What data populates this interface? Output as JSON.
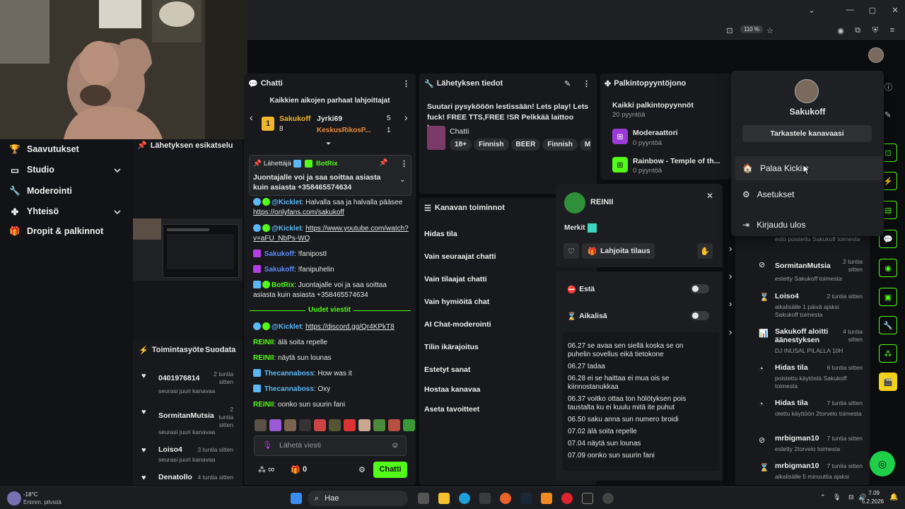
{
  "browser": {
    "zoom": "110 %"
  },
  "sidebar": {
    "items": [
      {
        "label": "Saavutukset",
        "icon": "trophy-icon"
      },
      {
        "label": "Studio",
        "icon": "studio-icon"
      },
      {
        "label": "Moderointi",
        "icon": "wrench-icon"
      },
      {
        "label": "Yhteisö",
        "icon": "community-icon"
      },
      {
        "label": "Dropit & palkinnot",
        "icon": "gift-icon"
      }
    ]
  },
  "preview": {
    "title": "Lähetyksen esikatselu"
  },
  "activity": {
    "title": "Toimintasyöte",
    "follow_label": "Suodata",
    "items": [
      {
        "name": "0401976814",
        "time": "2 tuntia sitten",
        "sub": "seurasi juuri kanavaa"
      },
      {
        "name": "SormitanMutsia",
        "time": "2 tuntia sitten",
        "sub": "seurasi juuri kanavaa"
      },
      {
        "name": "Loiso4",
        "time": "3 tuntia sitten",
        "sub": "seurasi juuri kanavaa"
      },
      {
        "name": "Denatollo",
        "time": "4 tuntia sitten",
        "sub": ""
      }
    ]
  },
  "chat": {
    "title": "Chatti",
    "gifters_title": "Kaikkien aikojen parhaat lahjoittajat",
    "gifters": [
      {
        "rank": "1",
        "name": "Sakukoff",
        "count": "8"
      },
      {
        "name": "Jyrki69",
        "count": "5"
      },
      {
        "name": "KeskusRikosP...",
        "count": "1"
      }
    ],
    "pinned": {
      "label": "Lähettäjä",
      "user": "BotRix",
      "text": "Juontajalle voi ja saa soittaa asiasta kuin asiasta +358465574634"
    },
    "messages": [
      {
        "user": "@Kicklet",
        "text": "Halvalla saa ja halvalla pääsee ",
        "link": "https://onlyfans.com/sakukoff"
      },
      {
        "user": "@Kicklet",
        "text": "",
        "link": "https://www.youtube.com/watch?v=aFU_NbPs-WQ"
      },
      {
        "user": "Sakukoff",
        "text": "!fanipostI"
      },
      {
        "user": "Sakukoff",
        "text": "!fanipuhelin"
      },
      {
        "user": "BotRix",
        "text": "Juontajalle voi ja saa soittaa asiasta kuin asiasta +358465574634"
      }
    ],
    "new_messages": "Uudet viestit",
    "messages2": [
      {
        "user": "@Kicklet",
        "link": "https://discord.gg/Qr4KPkT8"
      },
      {
        "user": "REINII",
        "text": "älä soita repelle"
      },
      {
        "user": "REINII",
        "text": "näytä sun lounas"
      },
      {
        "user": "Thecannaboss",
        "text": "How was it"
      },
      {
        "user": "Thecannaboss",
        "text": "Oxy"
      },
      {
        "user": "REINII",
        "text": "oonko sun suurin fani"
      }
    ],
    "input_placeholder": "Lähetä viesti",
    "points": "∞",
    "gifts": "0",
    "send_label": "Chatti"
  },
  "stream_info": {
    "title": "Lähetyksen tiedot",
    "description": "Suutari pysykööön lestissään! Lets play! Lets fuck! FREE TTS,FREE !SR Pelkkää laittoo kov...",
    "category": "Chatti",
    "tags": [
      "18+",
      "Finnish",
      "BEER",
      "Finnish",
      "M"
    ]
  },
  "channel_actions": {
    "title": "Kanavan toiminnot",
    "items": [
      "Hidas tila",
      "Vain seuraajat chatti",
      "Vain tilaajat chatti",
      "Vain hymiöitä chat",
      "AI Chat-moderointi",
      "Tilin ikärajoitus",
      "Estetyt sanat",
      "Hostaa kanavaa",
      "Aseta tavoitteet"
    ]
  },
  "rewards": {
    "title": "Palkintopyyntöjono",
    "all_title": "Kaikki palkintopyynnöt",
    "all_count": "20 pyyntöä",
    "items": [
      {
        "name": "Moderaattori",
        "count": "0 pyyntöä"
      },
      {
        "name": "Rainbow - Temple of th...",
        "count": "0 pyyntöä"
      }
    ]
  },
  "user_card": {
    "username": "REINII",
    "badges_label": "Merkit",
    "gift_label": "Lahjoita tilaus",
    "block_label": "Estä",
    "timeout_label": "Aikalisä",
    "history": [
      "06.27 se avaa sen siellä koska se on puhelin sovellus eikä tietokone",
      "06.27 tadaa",
      "06.28 ei se haittaa ei mua ois se kiinnostanukkaa",
      "06.37 voitko ottaa ton hölötyksen pois taustalta ku ei kuulu mitä ite puhut",
      "06.50 saku anna sun numero broidi",
      "07.02 älä soita repelle",
      "07.04 näytä sun lounas",
      "07.09 oonko sun suurin fani"
    ]
  },
  "mod_log": {
    "items": [
      {
        "text": "esto poistettu Sakukoff toimesta",
        "time": ""
      },
      {
        "name": "SormitanMutsia",
        "sub": "estetty Sakukoff toimesta",
        "time": "2 tuntia sitten"
      },
      {
        "name": "Loiso4",
        "sub": "aikalisälle 1 päivä ajaksi Sakukoff toimesta",
        "time": "2 tuntia sitten"
      },
      {
        "name": "Sakukoff aloitti äänestyksen",
        "sub": "DJ INUSAL PILALLA 10H",
        "time": "4 tuntia sitten"
      },
      {
        "name": "Hidas tila",
        "sub": "poistettu käytöstä Sakukoff toimesta",
        "time": "6 tuntia sitten"
      },
      {
        "name": "Hidas tila",
        "sub": "otettu käyttöön 2torvelo toimesta",
        "time": "7 tuntia sitten"
      },
      {
        "name": "mrbigman10",
        "sub": "estetty 2torvelo toimesta",
        "time": "7 tuntia sitten"
      },
      {
        "name": "mrbigman10",
        "sub": "aikalisälle 5 minuuttia ajaksi",
        "time": "7 tuntia sitten"
      }
    ]
  },
  "account_menu": {
    "username": "Sakukoff",
    "view_channel": "Tarkastele kanavaasi",
    "items": [
      "Palaa Kickiin",
      "Asetukset",
      "Kirjaudu ulos"
    ]
  },
  "taskbar": {
    "temp": "-18°C",
    "weather": "Enimm. pilvistä",
    "search": "Hae",
    "time": "7.09",
    "date": "5.2.2026"
  }
}
